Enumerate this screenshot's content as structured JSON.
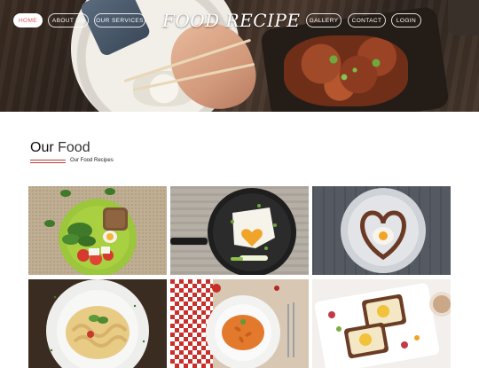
{
  "header": {
    "logo": "FOOD RECIPE",
    "nav_left": [
      "HOME",
      "ABOUT US",
      "OUR SERVICES"
    ],
    "nav_right": [
      "GALLERY",
      "CONTACT",
      "LOGIN"
    ],
    "active_item": "HOME"
  },
  "section": {
    "title_strong": "Our",
    "title_light": "Food",
    "subtitle": "Our Food Recipes"
  },
  "gallery": {
    "items": [
      "salad-plate-photo",
      "heart-egg-pan-photo",
      "heart-plate-photo",
      "pasta-plate-photo",
      "penne-plate-photo",
      "toast-platter-photo"
    ]
  },
  "colors": {
    "accent": "#e05757",
    "underline": "#c23a3a",
    "text": "#222222"
  }
}
